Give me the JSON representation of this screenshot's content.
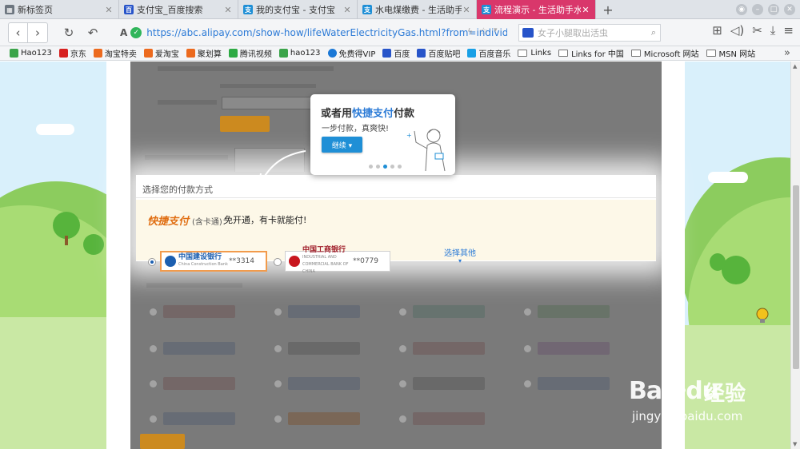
{
  "tabs": [
    {
      "label": "新标签页",
      "icon": "grid-icon",
      "active": false
    },
    {
      "label": "支付宝_百度搜索",
      "icon": "baidu-icon",
      "active": false
    },
    {
      "label": "我的支付宝 - 支付宝",
      "icon": "alipay-icon",
      "active": false
    },
    {
      "label": "水电煤缴费 - 生活助手",
      "icon": "alipay-icon",
      "active": false
    },
    {
      "label": "流程演示 - 生活助手水电...",
      "icon": "alipay-icon",
      "active": true
    }
  ],
  "new_tab_label": "+",
  "address": {
    "url": "https://abc.alipay.com/show-how/lifeWaterElectricityGas.html?from=individua"
  },
  "search": {
    "placeholder": "女子小腿取出活虫"
  },
  "bookmarks": [
    {
      "label": "Hao123",
      "color": "#3ba44a"
    },
    {
      "label": "京东",
      "color": "#d7201f"
    },
    {
      "label": "淘宝特卖",
      "color": "#ec6a1e"
    },
    {
      "label": "爱淘宝",
      "color": "#ec6a1e"
    },
    {
      "label": "聚划算",
      "color": "#ec6a1e"
    },
    {
      "label": "腾讯视频",
      "color": "#2eaa44"
    },
    {
      "label": "hao123",
      "color": "#3ba44a"
    },
    {
      "label": "免费得VIP",
      "color": "#1b78d6"
    },
    {
      "label": "百度",
      "color": "#2754c9"
    },
    {
      "label": "百度贴吧",
      "color": "#2754c9"
    },
    {
      "label": "百度音乐",
      "color": "#19a0e6"
    },
    {
      "label": "Links",
      "folder": true
    },
    {
      "label": "Links for 中国",
      "folder": true
    },
    {
      "label": "Microsoft 网站",
      "folder": true
    },
    {
      "label": "MSN 网站",
      "folder": true
    }
  ],
  "bookmarks_more": "»",
  "tooltip": {
    "title_prefix": "或者用",
    "title_highlight": "快捷支付",
    "title_suffix": "付款",
    "subtitle": "一步付款，真爽快!",
    "button_label": "继续 ▾",
    "dots": 5,
    "active_dot": 3
  },
  "payment": {
    "section_title": "选择您的付款方式",
    "quickpay_logo": "快捷支付",
    "quickpay_note": "(含卡通)：",
    "quickpay_desc": "免开通，有卡就能付!",
    "cards": [
      {
        "bank": "中国建设银行",
        "bank_en": "China Construction Bank",
        "tail": "**3314",
        "selected": true,
        "logo_color": "#1c5fb0"
      },
      {
        "bank": "中国工商银行",
        "bank_en": "INDUSTRIAL AND COMMERCIAL BANK OF CHINA",
        "tail": "**0779",
        "selected": false,
        "logo_color": "#c8161e"
      }
    ],
    "choose_other": "选择其他",
    "choose_other_arrow": "▾"
  },
  "colors": {
    "accent": "#d9376b",
    "alipay_blue": "#2a7ad6",
    "orange": "#e06e12",
    "sky": "#d9f0fb"
  },
  "watermark": {
    "brand": "Bai",
    "brand2": "du",
    "cn": "经验",
    "url": "jingyan.baidu.com"
  }
}
